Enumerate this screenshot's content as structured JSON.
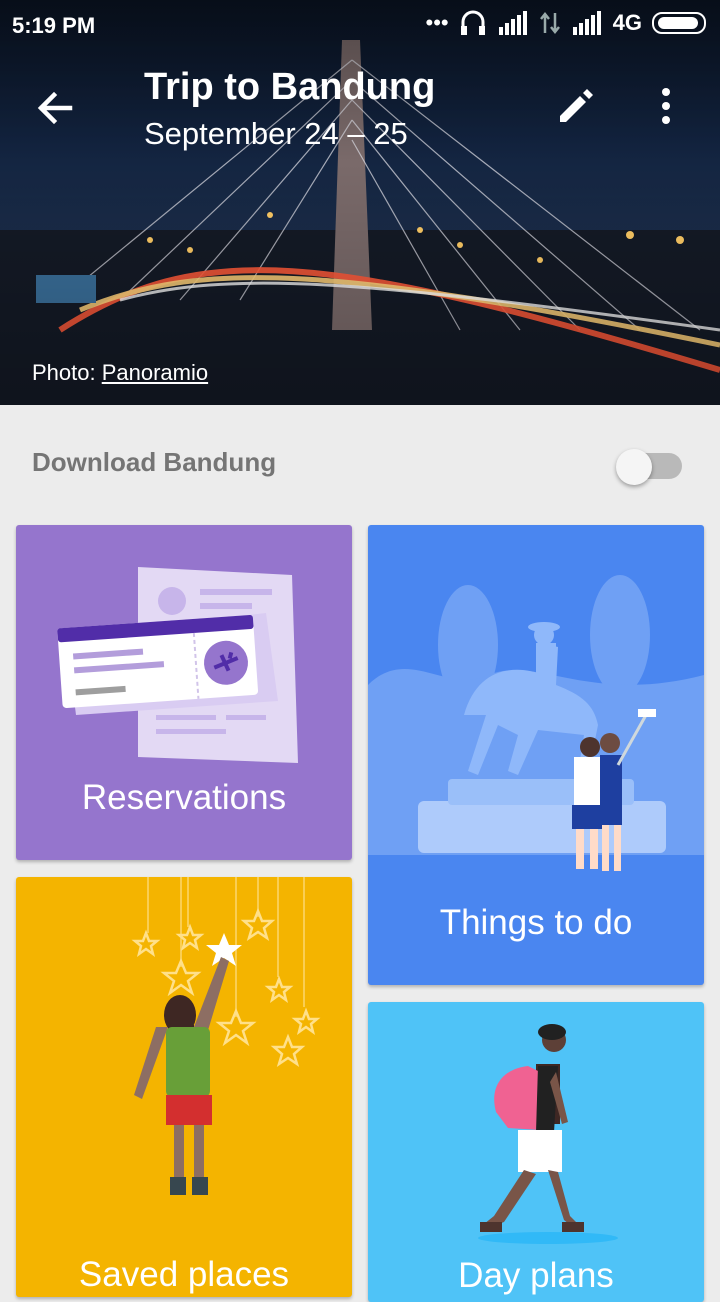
{
  "status_bar": {
    "time": "5:19 PM",
    "network": "4G",
    "icons": [
      "dots-icon",
      "headset-icon",
      "signal-icon",
      "data-arrows-icon",
      "signal-icon",
      "battery-icon"
    ]
  },
  "header": {
    "title": "Trip to Bandung",
    "subtitle": "September 24 – 25",
    "photo_credit_prefix": "Photo: ",
    "photo_credit_link": "Panoramio"
  },
  "download": {
    "label": "Download Bandung",
    "enabled": false
  },
  "cards": {
    "reservations": {
      "label": "Reservations",
      "color": "#9575cd"
    },
    "things_to_do": {
      "label": "Things to do",
      "color": "#4a86f0"
    },
    "saved_places": {
      "label": "Saved places",
      "color": "#f4b400"
    },
    "day_plans": {
      "label": "Day plans",
      "color": "#4fc3f7"
    }
  }
}
